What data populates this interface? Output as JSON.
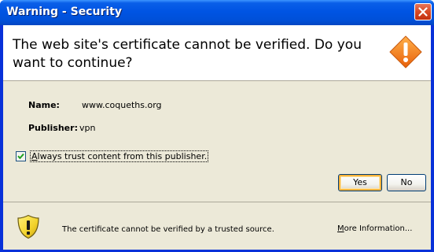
{
  "window": {
    "title": "Warning - Security",
    "close_icon": "close-icon"
  },
  "header": {
    "message": "The web site's certificate cannot be verified.  Do you want to continue?",
    "warning_icon": "warning-diamond-icon"
  },
  "details": {
    "name_label": "Name:",
    "name_value": "www.coqueths.org",
    "publisher_label": "Publisher:",
    "publisher_value": "vpn"
  },
  "trust": {
    "checked": true,
    "label_accel": "A",
    "label_rest": "lways trust content from this publisher."
  },
  "buttons": {
    "yes_label": "Yes",
    "no_label": "No",
    "default": "yes"
  },
  "footer": {
    "shield_icon": "shield-warning-icon",
    "message": "The certificate cannot be verified by a trusted source.",
    "more_info_accel": "M",
    "more_info_rest": "ore Information..."
  },
  "colors": {
    "titlebar": "#0054e3",
    "dialog_bg": "#ece9d8",
    "close_button": "#d84924",
    "warning_orange": "#f07e1b",
    "shield_yellow": "#f2d22b",
    "default_button_highlight": "#f8b33b"
  }
}
